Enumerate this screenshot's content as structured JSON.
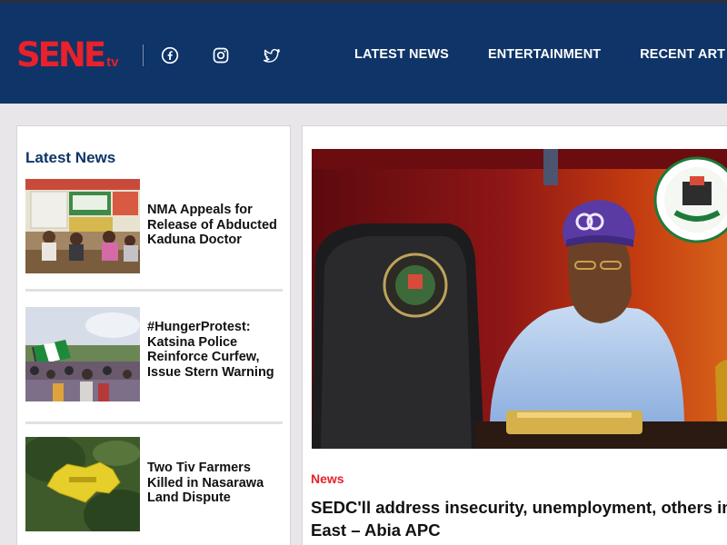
{
  "header": {
    "logo_main": "SENE",
    "logo_tv": "tv",
    "social": [
      "facebook-icon",
      "instagram-icon",
      "twitter-icon"
    ],
    "nav": [
      "LATEST NEWS",
      "ENTERTAINMENT",
      "RECENT ART"
    ]
  },
  "sidebar": {
    "title": "Latest News",
    "items": [
      {
        "headline": "NMA Appeals for Release of Abducted Kaduna Doctor"
      },
      {
        "headline": "#HungerProtest: Katsina Police Reinforce Curfew, Issue Stern Warning"
      },
      {
        "headline": "Two Tiv Farmers Killed in Nasarawa Land Dispute"
      }
    ]
  },
  "main": {
    "category": "News",
    "title_line1": "SEDC'll address insecurity, unemployment, others in",
    "title_line2": "East – Abia APC"
  },
  "colors": {
    "header_bg": "#0e3468",
    "brand_red": "#e8212a",
    "page_bg": "#e9e6ea"
  }
}
